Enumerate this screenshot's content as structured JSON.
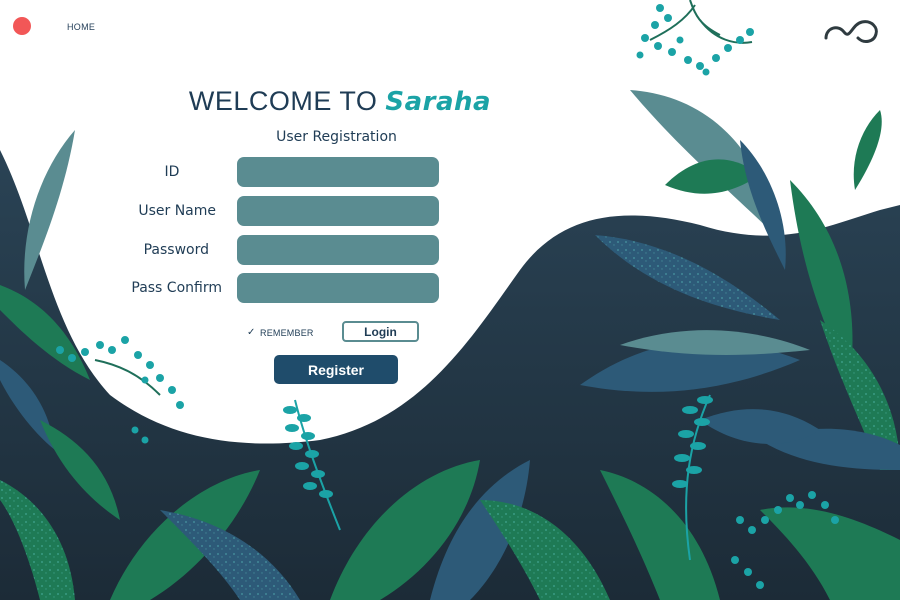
{
  "nav": {
    "home_label": "HOME"
  },
  "header": {
    "welcome_prefix": "WELCOME TO",
    "brand_name": "Saraha"
  },
  "form": {
    "title": "User Registration",
    "fields": [
      {
        "label": "ID",
        "value": ""
      },
      {
        "label": "User Name",
        "value": ""
      },
      {
        "label": "Password",
        "value": ""
      },
      {
        "label": "Pass Confirm",
        "value": ""
      }
    ],
    "remember_label": "REMEMBER",
    "remember_checked": true,
    "login_label": "Login",
    "register_label": "Register"
  },
  "icons": {
    "window_dot": "close-dot",
    "logo": "infinity-logo-icon",
    "check": "check-icon"
  },
  "colors": {
    "accent_teal": "#1ba3a6",
    "navy": "#1f3c55",
    "input_fill": "#5a8c91",
    "register_button": "#1f4c6b",
    "background_dark": "#233a4d",
    "close_dot": "#f25757"
  }
}
